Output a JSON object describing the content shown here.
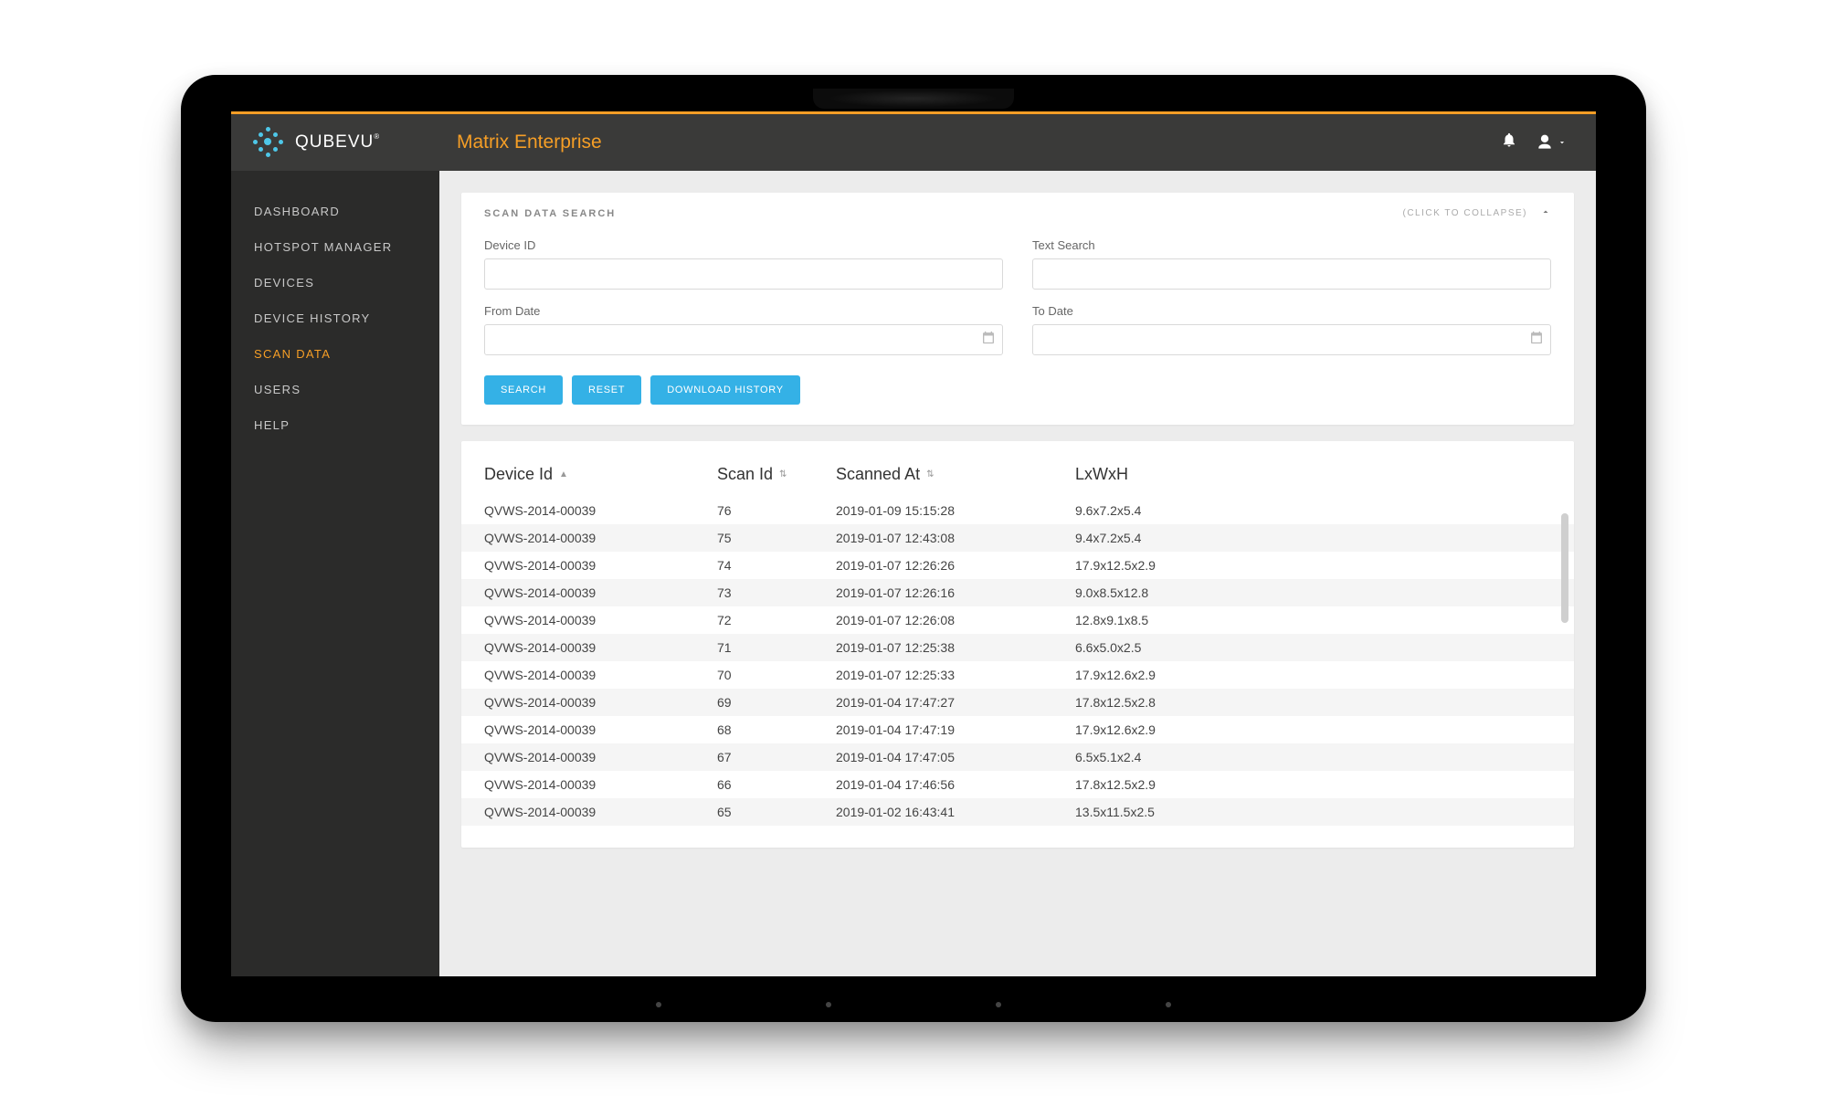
{
  "header": {
    "brand": "QUBEVU",
    "brand_mark": "®",
    "app_title": "Matrix Enterprise"
  },
  "sidebar": {
    "items": [
      {
        "label": "DASHBOARD",
        "active": false
      },
      {
        "label": "HOTSPOT MANAGER",
        "active": false
      },
      {
        "label": "DEVICES",
        "active": false
      },
      {
        "label": "DEVICE HISTORY",
        "active": false
      },
      {
        "label": "SCAN DATA",
        "active": true
      },
      {
        "label": "USERS",
        "active": false
      },
      {
        "label": "HELP",
        "active": false
      }
    ]
  },
  "search_panel": {
    "title": "SCAN DATA SEARCH",
    "collapse_hint": "(CLICK TO COLLAPSE)",
    "fields": {
      "device_id_label": "Device ID",
      "text_search_label": "Text Search",
      "from_date_label": "From Date",
      "to_date_label": "To Date",
      "device_id_value": "",
      "text_search_value": "",
      "from_date_value": "",
      "to_date_value": ""
    },
    "buttons": {
      "search": "SEARCH",
      "reset": "RESET",
      "download": "DOWNLOAD HISTORY"
    }
  },
  "table": {
    "columns": {
      "device_id": "Device Id",
      "scan_id": "Scan Id",
      "scanned_at": "Scanned At",
      "lwh": "LxWxH"
    },
    "rows": [
      {
        "device_id": "QVWS-2014-00039",
        "scan_id": "76",
        "scanned_at": "2019-01-09 15:15:28",
        "lwh": "9.6x7.2x5.4"
      },
      {
        "device_id": "QVWS-2014-00039",
        "scan_id": "75",
        "scanned_at": "2019-01-07 12:43:08",
        "lwh": "9.4x7.2x5.4"
      },
      {
        "device_id": "QVWS-2014-00039",
        "scan_id": "74",
        "scanned_at": "2019-01-07 12:26:26",
        "lwh": "17.9x12.5x2.9"
      },
      {
        "device_id": "QVWS-2014-00039",
        "scan_id": "73",
        "scanned_at": "2019-01-07 12:26:16",
        "lwh": "9.0x8.5x12.8"
      },
      {
        "device_id": "QVWS-2014-00039",
        "scan_id": "72",
        "scanned_at": "2019-01-07 12:26:08",
        "lwh": "12.8x9.1x8.5"
      },
      {
        "device_id": "QVWS-2014-00039",
        "scan_id": "71",
        "scanned_at": "2019-01-07 12:25:38",
        "lwh": "6.6x5.0x2.5"
      },
      {
        "device_id": "QVWS-2014-00039",
        "scan_id": "70",
        "scanned_at": "2019-01-07 12:25:33",
        "lwh": "17.9x12.6x2.9"
      },
      {
        "device_id": "QVWS-2014-00039",
        "scan_id": "69",
        "scanned_at": "2019-01-04 17:47:27",
        "lwh": "17.8x12.5x2.8"
      },
      {
        "device_id": "QVWS-2014-00039",
        "scan_id": "68",
        "scanned_at": "2019-01-04 17:47:19",
        "lwh": "17.9x12.6x2.9"
      },
      {
        "device_id": "QVWS-2014-00039",
        "scan_id": "67",
        "scanned_at": "2019-01-04 17:47:05",
        "lwh": "6.5x5.1x2.4"
      },
      {
        "device_id": "QVWS-2014-00039",
        "scan_id": "66",
        "scanned_at": "2019-01-04 17:46:56",
        "lwh": "17.8x12.5x2.9"
      },
      {
        "device_id": "QVWS-2014-00039",
        "scan_id": "65",
        "scanned_at": "2019-01-02 16:43:41",
        "lwh": "13.5x11.5x2.5"
      }
    ]
  }
}
